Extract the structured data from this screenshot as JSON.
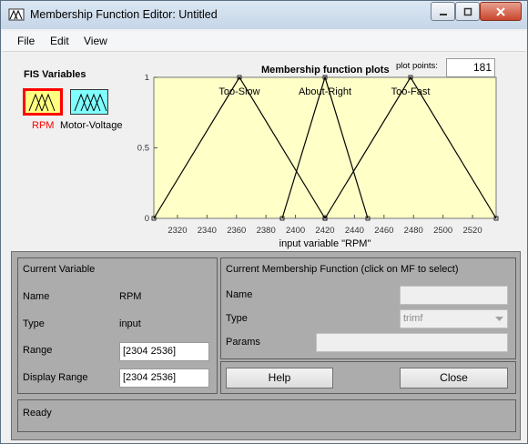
{
  "window": {
    "title": "Membership Function Editor: Untitled"
  },
  "menu": {
    "items": [
      "File",
      "Edit",
      "View"
    ]
  },
  "fis": {
    "heading": "FIS Variables",
    "input_label": "RPM",
    "output_label": "Motor-Voltage"
  },
  "plot": {
    "title": "Membership function plots",
    "plot_points_label": "plot points:",
    "plot_points_value": "181",
    "xlabel": "input variable \"RPM\"",
    "x_ticks": [
      "2320",
      "2340",
      "2360",
      "2380",
      "2400",
      "2420",
      "2440",
      "2460",
      "2480",
      "2500",
      "2520"
    ],
    "y_ticks": [
      "1",
      "0.5",
      "0"
    ],
    "mf_labels": [
      "Too-Slow",
      "About-Right",
      "Too-Fast"
    ]
  },
  "chart_data": {
    "type": "line",
    "xlim": [
      2304,
      2536
    ],
    "ylim": [
      0,
      1
    ],
    "xlabel": "input variable \"RPM\"",
    "series": [
      {
        "name": "Too-Slow",
        "x": [
          2304,
          2362,
          2420
        ],
        "y": [
          0,
          1,
          0
        ]
      },
      {
        "name": "About-Right",
        "x": [
          2391,
          2420,
          2449
        ],
        "y": [
          0,
          1,
          0
        ]
      },
      {
        "name": "Too-Fast",
        "x": [
          2420,
          2478,
          2536
        ],
        "y": [
          0,
          1,
          0
        ]
      }
    ],
    "grid": false
  },
  "current_variable": {
    "heading": "Current Variable",
    "name_label": "Name",
    "name_value": "RPM",
    "type_label": "Type",
    "type_value": "input",
    "range_label": "Range",
    "range_value": "[2304 2536]",
    "display_range_label": "Display Range",
    "display_range_value": "[2304 2536]"
  },
  "current_mf": {
    "heading": "Current Membership Function (click on MF to select)",
    "name_label": "Name",
    "name_value": "",
    "type_label": "Type",
    "type_value": "trimf",
    "params_label": "Params",
    "params_value": ""
  },
  "buttons": {
    "help": "Help",
    "close": "Close"
  },
  "status": {
    "text": "Ready"
  },
  "colors": {
    "plot_bg": "#ffffc8",
    "input_box": "#ffff80",
    "output_box": "#80ffff",
    "selected_border": "#ff0000"
  }
}
